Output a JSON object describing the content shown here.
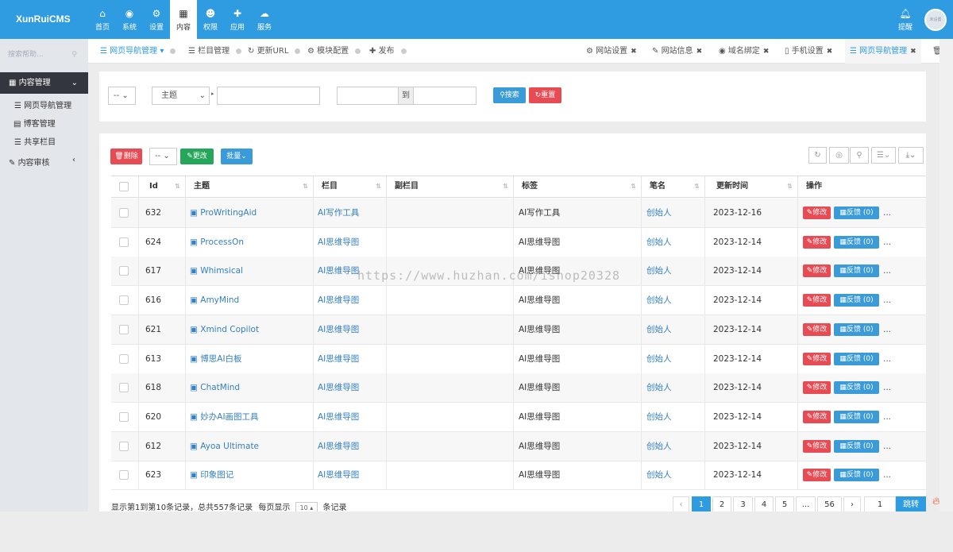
{
  "topbar": {
    "logo": "XunRuiCMS",
    "nav": [
      {
        "label": "首页",
        "icon": "home-icon",
        "glyph": "⌂"
      },
      {
        "label": "系统",
        "icon": "globe-icon",
        "glyph": "◉"
      },
      {
        "label": "设置",
        "icon": "cogs-icon",
        "glyph": "⚙"
      },
      {
        "label": "内容",
        "icon": "grid-icon",
        "glyph": "▦"
      },
      {
        "label": "权限",
        "icon": "user-icon",
        "glyph": "☻"
      },
      {
        "label": "应用",
        "icon": "puzzle-icon",
        "glyph": "✚"
      },
      {
        "label": "服务",
        "icon": "cloud-icon",
        "glyph": "☁"
      }
    ],
    "notify": "提醒",
    "avatar_text": "未设置"
  },
  "sidebar": {
    "search_placeholder": "搜索帮助...",
    "section": "内容管理",
    "items": [
      "网页导航管理",
      "博客管理",
      "共享栏目"
    ],
    "review": "内容审核"
  },
  "tabs": {
    "left": [
      {
        "label": "网页导航管理 ▾"
      },
      {
        "label": "栏目管理"
      },
      {
        "label": "更新URL"
      },
      {
        "label": "模块配置"
      },
      {
        "label": "发布"
      }
    ],
    "right": [
      {
        "label": "网站设置"
      },
      {
        "label": "网站信息"
      },
      {
        "label": "域名绑定"
      },
      {
        "label": "手机设置"
      },
      {
        "label": "网页导航管理"
      }
    ]
  },
  "filter": {
    "sel1": "-- ",
    "field": "主题",
    "to": "到",
    "search": "搜索",
    "reset": "重置"
  },
  "toolbar": {
    "delete": "删除",
    "sel": "--",
    "change": "更改",
    "batch": "批量"
  },
  "table": {
    "headers": [
      "Id",
      "主题",
      "栏目",
      "副栏目",
      "标签",
      "笔名",
      "更新时间",
      "操作"
    ],
    "edit": "修改",
    "feedback": "反馈",
    "feedback_count": "(0)",
    "more": "...",
    "rows": [
      {
        "id": "632",
        "title": "ProWritingAid",
        "cat": "AI写作工具",
        "tag": "AI写作工具",
        "author": "创始人",
        "date": "2023-12-16"
      },
      {
        "id": "624",
        "title": "ProcessOn",
        "cat": "AI思维导图",
        "tag": "AI思维导图",
        "author": "创始人",
        "date": "2023-12-14"
      },
      {
        "id": "617",
        "title": "Whimsical",
        "cat": "AI思维导图",
        "tag": "AI思维导图",
        "author": "创始人",
        "date": "2023-12-14"
      },
      {
        "id": "616",
        "title": "AmyMind",
        "cat": "AI思维导图",
        "tag": "AI思维导图",
        "author": "创始人",
        "date": "2023-12-14"
      },
      {
        "id": "621",
        "title": "Xmind Copilot",
        "cat": "AI思维导图",
        "tag": "AI思维导图",
        "author": "创始人",
        "date": "2023-12-14"
      },
      {
        "id": "613",
        "title": "博思AI白板",
        "cat": "AI思维导图",
        "tag": "AI思维导图",
        "author": "创始人",
        "date": "2023-12-14"
      },
      {
        "id": "618",
        "title": "ChatMind",
        "cat": "AI思维导图",
        "tag": "AI思维导图",
        "author": "创始人",
        "date": "2023-12-14"
      },
      {
        "id": "620",
        "title": "妙办AI画图工具",
        "cat": "AI思维导图",
        "tag": "AI思维导图",
        "author": "创始人",
        "date": "2023-12-14"
      },
      {
        "id": "612",
        "title": "Ayoa Ultimate",
        "cat": "AI思维导图",
        "tag": "AI思维导图",
        "author": "创始人",
        "date": "2023-12-14"
      },
      {
        "id": "623",
        "title": "印象图记",
        "cat": "AI思维导图",
        "tag": "AI思维导图",
        "author": "创始人",
        "date": "2023-12-14"
      }
    ]
  },
  "footer": {
    "summary": "显示第1到第10条记录，总共557条记录",
    "per_page_label": "每页显示",
    "per_page": "10 ▴",
    "records": "条记录"
  },
  "pagination": {
    "prev": "‹",
    "pages": [
      "1",
      "2",
      "3",
      "4",
      "5",
      "...",
      "56"
    ],
    "next": "›",
    "jump_value": "1",
    "jump": "跳转"
  },
  "watermark": "https://www.huzhan.com/ishop20328"
}
